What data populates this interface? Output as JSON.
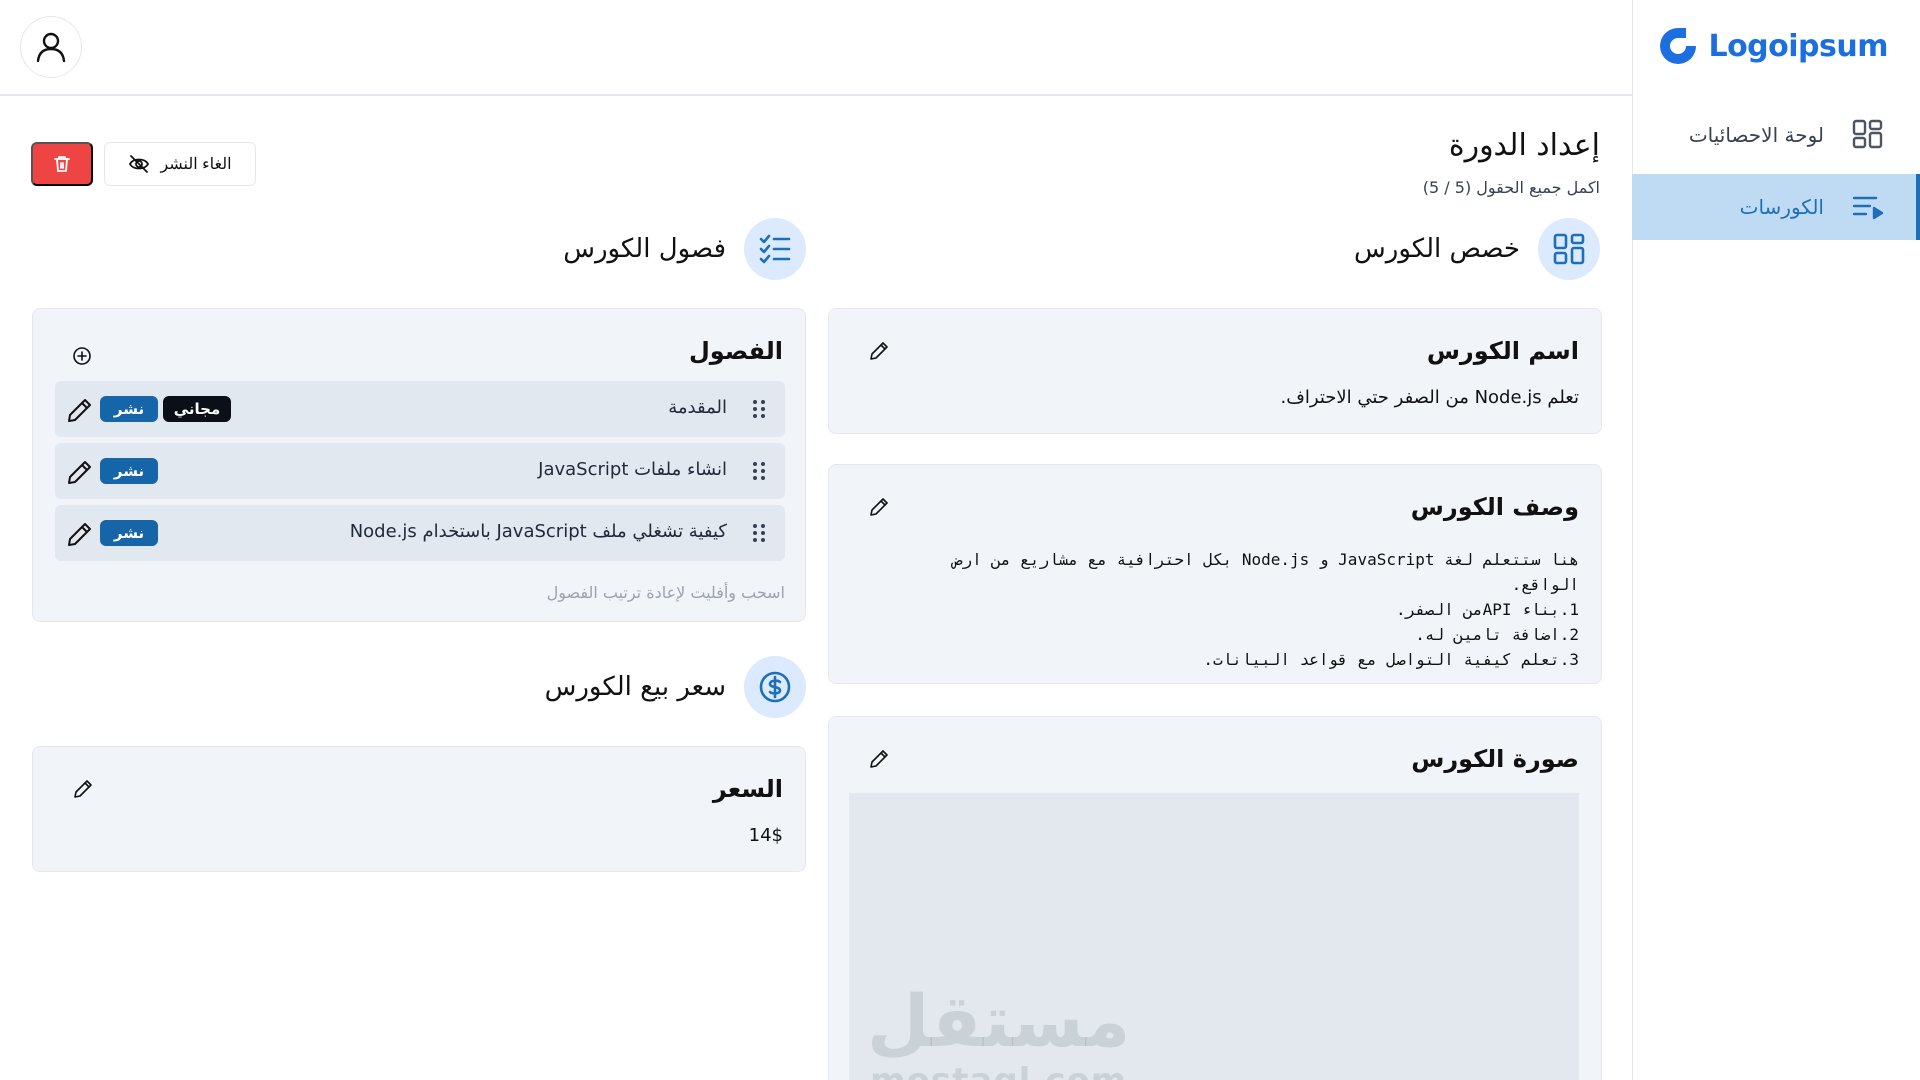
{
  "brand": {
    "name": "Logoipsum",
    "color": "#1d6fe0"
  },
  "sidebar": {
    "items": [
      {
        "label": "لوحة الاحصائيات",
        "icon": "dashboard-grid-icon",
        "active": false
      },
      {
        "label": "الكورسات",
        "icon": "courses-list-icon",
        "active": true
      }
    ]
  },
  "header": {
    "avatar_icon": "user-icon"
  },
  "page": {
    "title": "إعداد الدورة",
    "subtitle": "اكمل جميع الحقول (5 / 5)",
    "unpublish_label": "الغاء النشر",
    "delete_icon": "trash-icon"
  },
  "sections": {
    "customize": "خصص الكورس",
    "chapters": "فصول الكورس",
    "price": "سعر بيع الكورس"
  },
  "cards": {
    "name": {
      "title": "اسم الكورس",
      "value": "تعلم Node.js من الصفر حتي الاحتراف."
    },
    "description": {
      "title": "وصف الكورس",
      "value": "هنا ستتعلم لغة JavaScript و Node.js بكل احترافية مع مشاريع من ارض الواقع.\n1.بناء APIمن الصفر.\n2.اضافة تامين له.\n3.تعلم كيفية التواصل مع قواعد البيانات."
    },
    "image": {
      "title": "صورة الكورس",
      "watermark_ar": "مستقل",
      "watermark_en": "mostaql.com"
    },
    "chapters": {
      "title": "الفصول",
      "items": [
        {
          "label": "المقدمة",
          "publish": "نشر",
          "free": "مجاني"
        },
        {
          "label": "انشاء ملفات JavaScript",
          "publish": "نشر"
        },
        {
          "label": "كيفية تشغلي ملف JavaScript باستخدام Node.js",
          "publish": "نشر"
        }
      ],
      "hint": "اسحب وأفليت لإعادة ترتيب الفصول"
    },
    "price": {
      "title": "السعر",
      "value": "14$"
    }
  },
  "colors": {
    "accent": "#1f6fb8",
    "danger": "#ef4444",
    "publish_badge": "#1565a8",
    "free_badge": "#0b0f17"
  }
}
